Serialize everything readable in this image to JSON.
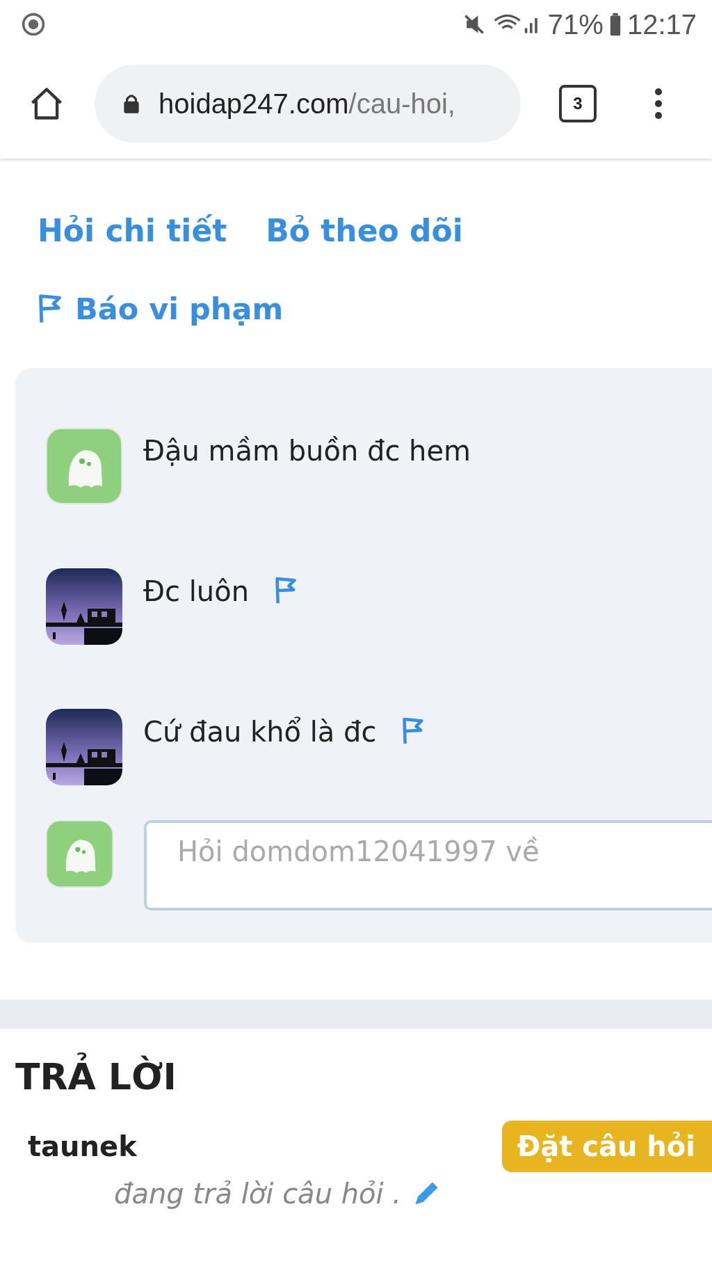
{
  "status_bar": {
    "battery": "71%",
    "time": "12:17"
  },
  "browser": {
    "url_domain": "hoidap247.com",
    "url_path": "/cau-hoi,",
    "tab_count": "3"
  },
  "actions": [
    {
      "label": "Hỏi chi tiết"
    },
    {
      "label": "Bỏ theo dõi"
    }
  ],
  "report_link": "Báo vi phạm",
  "comments": [
    {
      "kind": "ghost",
      "text": "Đậu mầm buồn đc hem",
      "reportable": false
    },
    {
      "kind": "picture",
      "text": "Đc luôn",
      "reportable": true
    },
    {
      "kind": "picture",
      "text": "Cứ đau khổ là đc",
      "reportable": true
    }
  ],
  "comment_input": {
    "kind": "ghost",
    "placeholder": "Hỏi domdom12041997 về"
  },
  "answers": {
    "title": "TRẢ LỜI",
    "user": "taunek",
    "status": "đang trả lời câu hỏi .",
    "ask_button": "Đặt câu hỏi"
  }
}
